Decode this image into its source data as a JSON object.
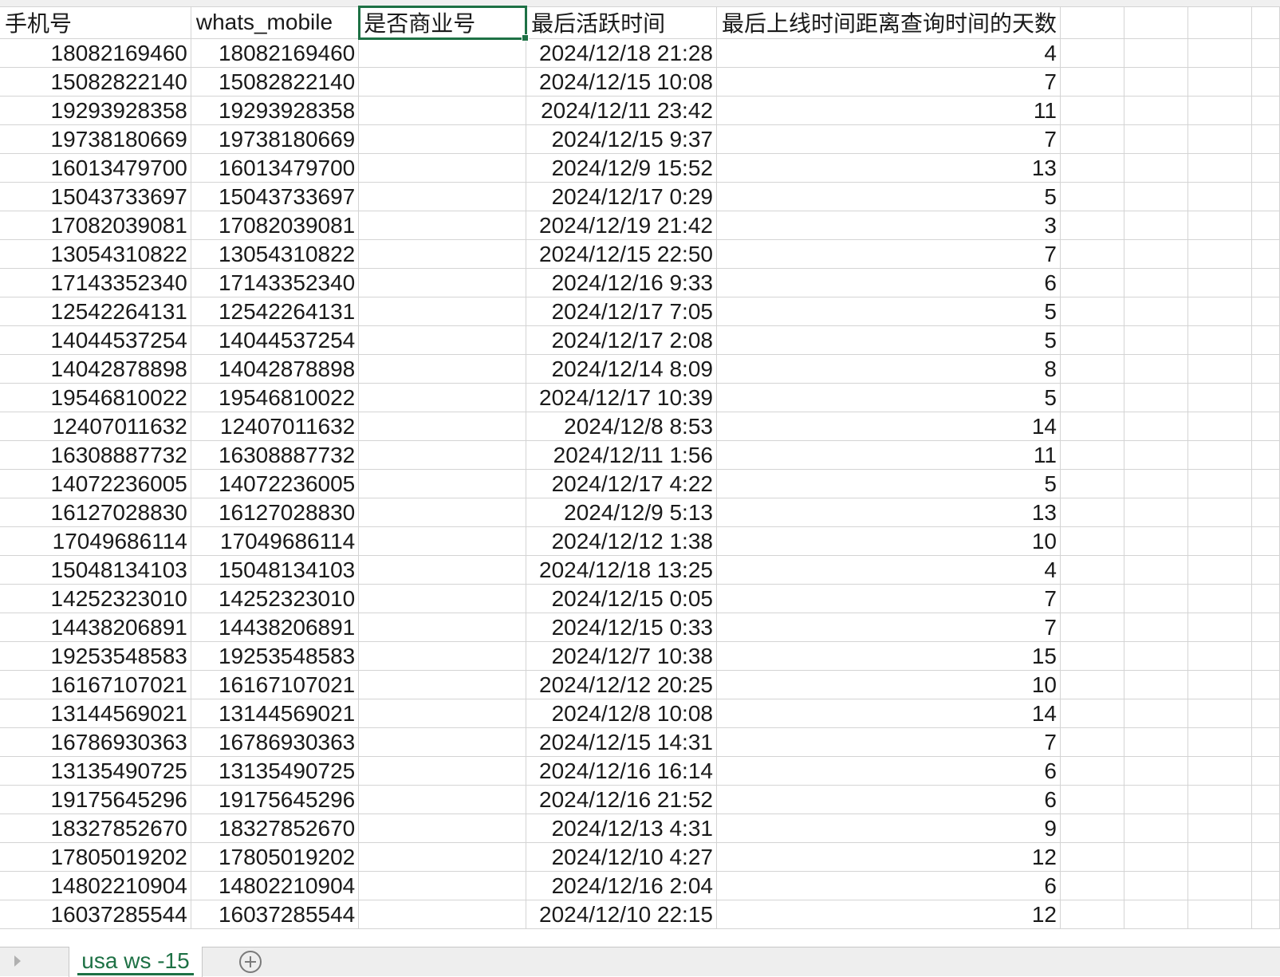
{
  "sheet": {
    "headers": [
      "手机号",
      "whats_mobile",
      "是否商业号",
      "最后活跃时间",
      "最后上线时间距离查询时间的天数",
      "",
      "",
      "",
      ""
    ],
    "rows": [
      [
        "18082169460",
        "18082169460",
        "",
        "2024/12/18 21:28",
        "4"
      ],
      [
        "15082822140",
        "15082822140",
        "",
        "2024/12/15 10:08",
        "7"
      ],
      [
        "19293928358",
        "19293928358",
        "",
        "2024/12/11 23:42",
        "11"
      ],
      [
        "19738180669",
        "19738180669",
        "",
        "2024/12/15 9:37",
        "7"
      ],
      [
        "16013479700",
        "16013479700",
        "",
        "2024/12/9 15:52",
        "13"
      ],
      [
        "15043733697",
        "15043733697",
        "",
        "2024/12/17 0:29",
        "5"
      ],
      [
        "17082039081",
        "17082039081",
        "",
        "2024/12/19 21:42",
        "3"
      ],
      [
        "13054310822",
        "13054310822",
        "",
        "2024/12/15 22:50",
        "7"
      ],
      [
        "17143352340",
        "17143352340",
        "",
        "2024/12/16 9:33",
        "6"
      ],
      [
        "12542264131",
        "12542264131",
        "",
        "2024/12/17 7:05",
        "5"
      ],
      [
        "14044537254",
        "14044537254",
        "",
        "2024/12/17 2:08",
        "5"
      ],
      [
        "14042878898",
        "14042878898",
        "",
        "2024/12/14 8:09",
        "8"
      ],
      [
        "19546810022",
        "19546810022",
        "",
        "2024/12/17 10:39",
        "5"
      ],
      [
        "12407011632",
        "12407011632",
        "",
        "2024/12/8 8:53",
        "14"
      ],
      [
        "16308887732",
        "16308887732",
        "",
        "2024/12/11 1:56",
        "11"
      ],
      [
        "14072236005",
        "14072236005",
        "",
        "2024/12/17 4:22",
        "5"
      ],
      [
        "16127028830",
        "16127028830",
        "",
        "2024/12/9 5:13",
        "13"
      ],
      [
        "17049686114",
        "17049686114",
        "",
        "2024/12/12 1:38",
        "10"
      ],
      [
        "15048134103",
        "15048134103",
        "",
        "2024/12/18 13:25",
        "4"
      ],
      [
        "14252323010",
        "14252323010",
        "",
        "2024/12/15 0:05",
        "7"
      ],
      [
        "14438206891",
        "14438206891",
        "",
        "2024/12/15 0:33",
        "7"
      ],
      [
        "19253548583",
        "19253548583",
        "",
        "2024/12/7 10:38",
        "15"
      ],
      [
        "16167107021",
        "16167107021",
        "",
        "2024/12/12 20:25",
        "10"
      ],
      [
        "13144569021",
        "13144569021",
        "",
        "2024/12/8 10:08",
        "14"
      ],
      [
        "16786930363",
        "16786930363",
        "",
        "2024/12/15 14:31",
        "7"
      ],
      [
        "13135490725",
        "13135490725",
        "",
        "2024/12/16 16:14",
        "6"
      ],
      [
        "19175645296",
        "19175645296",
        "",
        "2024/12/16 21:52",
        "6"
      ],
      [
        "18327852670",
        "18327852670",
        "",
        "2024/12/13 4:31",
        "9"
      ],
      [
        "17805019202",
        "17805019202",
        "",
        "2024/12/10 4:27",
        "12"
      ],
      [
        "14802210904",
        "14802210904",
        "",
        "2024/12/16 2:04",
        "6"
      ],
      [
        "16037285544",
        "16037285544",
        "",
        "2024/12/10 22:15",
        "12"
      ]
    ]
  },
  "tabs": {
    "active_sheet": "usa ws -15"
  },
  "colors": {
    "accent": "#1e7145",
    "gridline": "#d4d4d4"
  },
  "icons": {
    "prev": "triangle-right-icon",
    "add": "plus-circle-icon"
  }
}
